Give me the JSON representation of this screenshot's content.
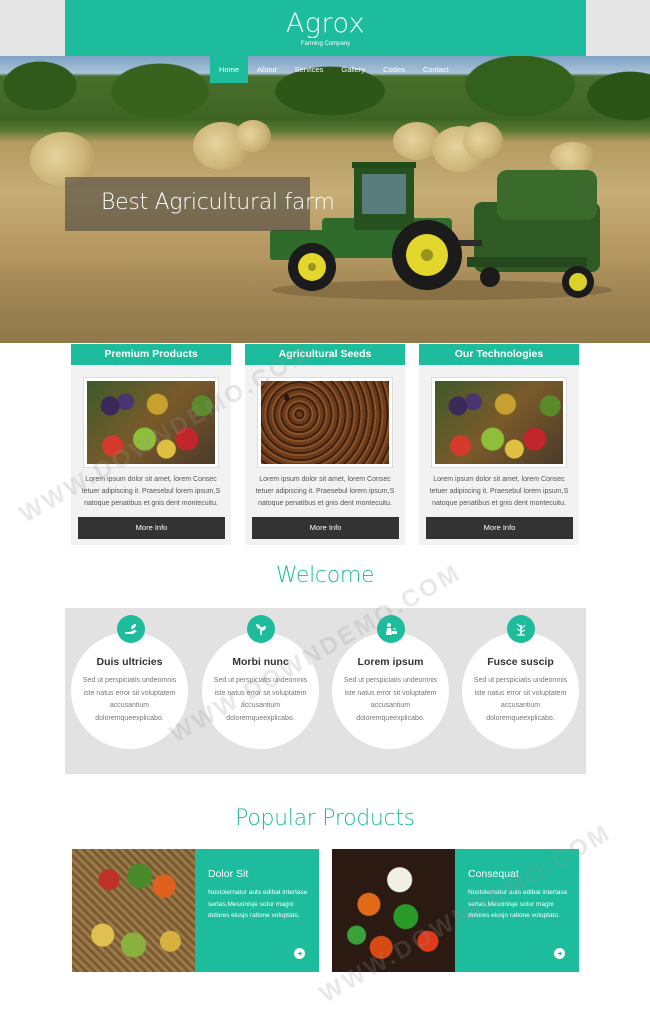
{
  "brand": {
    "title": "Agrox",
    "subtitle": "Farming Company",
    "accent": "#1cbc9c"
  },
  "nav": {
    "items": [
      "Home",
      "About",
      "Services",
      "Gallery",
      "Codes",
      "Contact"
    ],
    "active": "Home"
  },
  "hero": {
    "caption": "Best Agricultural farm"
  },
  "features": [
    {
      "title": "Premium Products",
      "image": "fruits-image",
      "text": "Lorem ipsum dolor sit amet, lorem Consec tetuer adipiscing it. Praesebul lorem ipsum,S natoque penatibus et gnis dent montecuitu.",
      "button": "More Info"
    },
    {
      "title": "Agricultural Seeds",
      "image": "coffee-seeds-image",
      "text": "Lorem ipsum dolor sit amet, lorem Consec tetuer adipiscing it. Praesebul lorem ipsum,S natoque penatibus et gnis dent montecuitu.",
      "button": "More Info"
    },
    {
      "title": "Our Technologies",
      "image": "fruits-image",
      "text": "Lorem ipsum dolor sit amet, lorem Consec tetuer adipiscing it. Praesebul lorem ipsum,S natoque penatibus et gnis dent montecuitu.",
      "button": "More Info"
    }
  ],
  "welcome": {
    "title": "Welcome",
    "items": [
      {
        "icon": "hand-leaf-icon",
        "title": "Duis ultricies",
        "text": "Sed ut perspiciatis undeomnis iste natus error sit voluptatem accusantium doloremqueexplicabo."
      },
      {
        "icon": "sprout-icon",
        "title": "Morbi nunc",
        "text": "Sed ut perspiciatis undeomnis iste natus error sit voluptatem accusantium doloremqueexplicabo."
      },
      {
        "icon": "farmer-icon",
        "title": "Lorem ipsum",
        "text": "Sed ut perspiciatis undeomnis iste natus error sit voluptatem accusantium doloremqueexplicabo."
      },
      {
        "icon": "tree-icon",
        "title": "Fusce suscip",
        "text": "Sed ut perspiciatis undeomnis iste natus error sit voluptatem accusantium doloremqueexplicabo."
      }
    ]
  },
  "products": {
    "title": "Popular Products",
    "items": [
      {
        "image": "fruit-basket-image",
        "title": "Dolor Sit",
        "text": "Nostolernatur auts edibat intertase sertas,Mesxinisje sotur magni dolores eiusjo ratione voluptato."
      },
      {
        "image": "vegetables-image",
        "title": "Consequat",
        "text": "Nostolernatur auts edibat intertase sertas,Mesxinisje sotur magni dolores eiusjo ratione voluptato."
      }
    ]
  },
  "watermark": "WWW.DOWNDEMO.COM"
}
